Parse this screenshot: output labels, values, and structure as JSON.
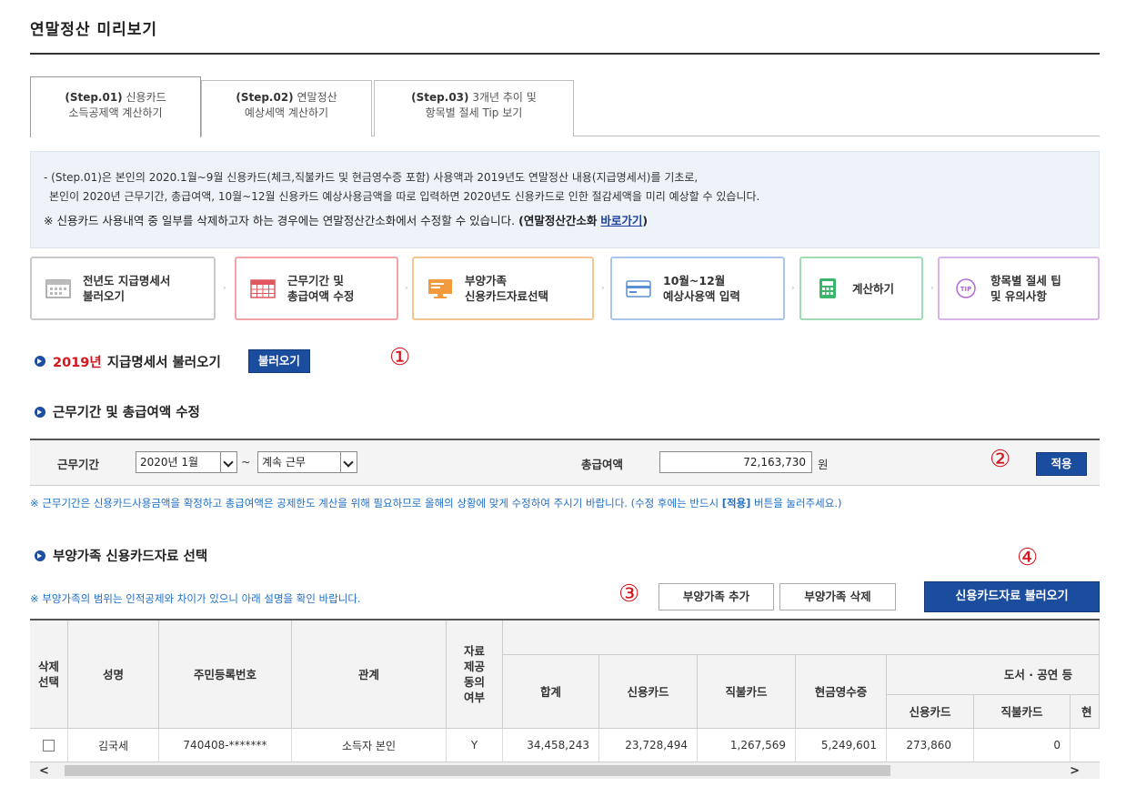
{
  "page": {
    "title": "연말정산 미리보기"
  },
  "tabs": [
    {
      "step": "(Step.01)",
      "line1": "신용카드",
      "line2": "소득공제액 계산하기"
    },
    {
      "step": "(Step.02)",
      "line1": "연말정산",
      "line2": "예상세액 계산하기"
    },
    {
      "step": "(Step.03)",
      "line1": "3개년 추이 및",
      "line2": "항목별 절세 Tip 보기"
    }
  ],
  "info": {
    "line1": "- (Step.01)은 본인의 2020.1월~9월 신용카드(체크,직불카드 및 현금영수증 포함) 사용액과 2019년도 연말정산 내용(지급명세서)를 기초로,",
    "line2": "본인이 2020년 근무기간, 총급여액, 10월~12월 신용카드 예상사용금액을 따로 입력하면 2020년도 신용카드로 인한 절감세액을 미리 예상할 수 있습니다.",
    "note_text": "※ 신용카드 사용내역 중 일부를 삭제하고자 하는 경우에는 연말정산간소화에서 수정할 수 있습니다.",
    "note_bold": "(연말정산간소화",
    "note_link": "바로가기",
    "note_close": ")"
  },
  "steps": [
    {
      "line1": "전년도 지급명세서",
      "line2": "불러오기",
      "icon": "calendar-icon",
      "color": "#c9c9c9"
    },
    {
      "line1": "근무기간 및",
      "line2": "총급여액 수정",
      "icon": "grid-calendar-icon",
      "color": "#f2a3a6"
    },
    {
      "line1": "부양가족",
      "line2": "신용카드자료선택",
      "icon": "monitor-icon",
      "color": "#f7c48f"
    },
    {
      "line1": "10월~12월",
      "line2": "예상사용액 입력",
      "icon": "card-icon",
      "color": "#a9c6ea"
    },
    {
      "line1": "계산하기",
      "line2": "",
      "icon": "calculator-icon",
      "color": "#9fdcb4"
    },
    {
      "line1": "항목별 절세 팁",
      "line2": "및 유의사항",
      "icon": "tip-icon",
      "color": "#d9b4ea"
    }
  ],
  "section1": {
    "year": "2019년",
    "title": "지급명세서 불러오기",
    "button": "불러오기",
    "marker": "①"
  },
  "section2": {
    "title": "근무기간 및 총급여액 수정",
    "period_label": "근무기간",
    "period_start": "2020년 1월",
    "tilde": "~",
    "period_end": "계속 근무",
    "salary_label": "총급여액",
    "salary_value": "72,163,730",
    "unit": "원",
    "apply_button": "적용",
    "marker": "②",
    "note_prefix": "※ 근무기간은 신용카드사용금액을 확정하고 총급여액은 공제한도 계산을 위해 필요하므로 올해의 상황에 맞게 수정하여 주시기 바랍니다. (수정 후에는 반드시",
    "note_bold": "[적용]",
    "note_suffix": "버튼을 눌러주세요.)"
  },
  "section3": {
    "title": "부양가족 신용카드자료 선택",
    "note": "※ 부양가족의 범위는 인적공제와 차이가 있으니 아래 설명을 확인 바랍니다.",
    "add_button": "부양가족 추가",
    "delete_button": "부양가족 삭제",
    "load_button": "신용카드자료 불러오기",
    "marker3": "③",
    "marker4": "④"
  },
  "table": {
    "headers": {
      "delete_select": "삭제\n선택",
      "name": "성명",
      "rrn": "주민등록번호",
      "relation": "관계",
      "consent": "자료\n제공\n동의\n여부",
      "total": "합계",
      "credit": "신용카드",
      "debit": "직불카드",
      "cash": "현금영수증",
      "books_group": "도서 · 공연 등",
      "books_credit": "신용카드",
      "books_debit": "직불카드",
      "books_cash": "현"
    },
    "rows": [
      {
        "name": "김국세",
        "rrn": "740408-*******",
        "relation": "소득자 본인",
        "consent": "Y",
        "total": "34,458,243",
        "credit": "23,728,494",
        "debit": "1,267,569",
        "cash": "5,249,601",
        "books_credit": "273,860",
        "books_debit": "0"
      }
    ]
  },
  "scroll": {
    "left": "<",
    "right": ">"
  }
}
